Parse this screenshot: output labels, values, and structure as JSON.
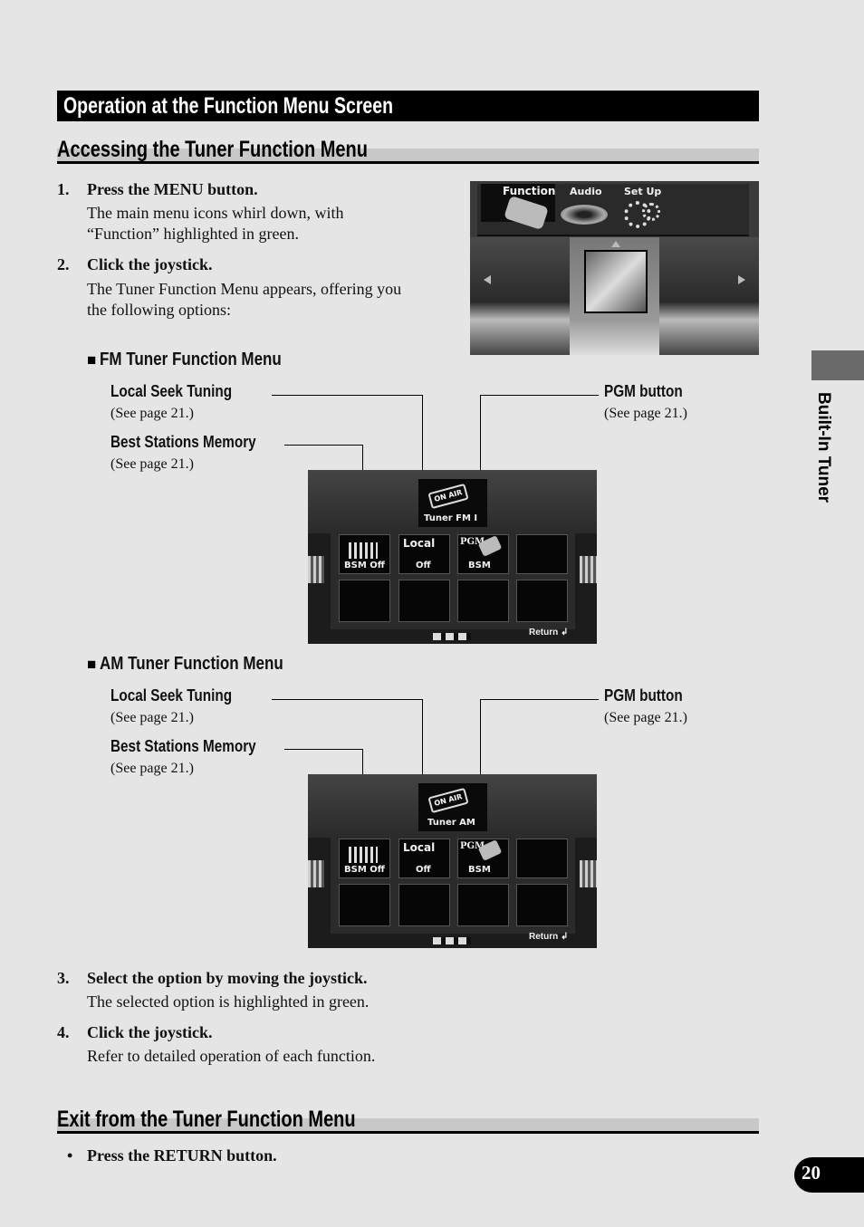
{
  "section_title": "Operation at the Function Menu Screen",
  "subsections": {
    "accessing": {
      "title": "Accessing the Tuner Function Menu"
    },
    "exit": {
      "title": "Exit from the Tuner Function Menu"
    }
  },
  "steps": [
    {
      "num": "1.",
      "title": "Press the MENU button.",
      "body_lines": [
        "The main menu icons whirl down, with",
        "“Function” highlighted in green."
      ]
    },
    {
      "num": "2.",
      "title": "Click the joystick.",
      "body_lines": [
        "The Tuner Function Menu appears, offering you",
        "the following options:"
      ]
    },
    {
      "num": "3.",
      "title": "Select the option by moving the joystick.",
      "body_lines": [
        "The selected option is highlighted in green."
      ]
    },
    {
      "num": "4.",
      "title": "Click the joystick.",
      "body_lines": [
        "Refer to detailed operation of each function."
      ]
    }
  ],
  "main_menu_screen": {
    "items": [
      "Function",
      "Audio",
      "Set Up"
    ],
    "icons": [
      "remote-control-icon",
      "speaker-icon",
      "gears-icon"
    ]
  },
  "menus": [
    {
      "heading": "FM Tuner Function Menu",
      "bullet": "■",
      "callouts": {
        "local_seek": {
          "label": "Local Seek Tuning",
          "ref": "(See page 21.)"
        },
        "bsm": {
          "label": "Best Stations Memory",
          "ref": "(See page 21.)"
        },
        "pgm": {
          "label": "PGM button",
          "ref": "(See page 21.)"
        }
      },
      "screen": {
        "title": "Tuner FM I",
        "onair": "ON AIR",
        "tiles": [
          {
            "top": "",
            "bottom": "BSM Off"
          },
          {
            "top": "Local",
            "bottom": "Off"
          },
          {
            "top": "PGM",
            "bottom": "BSM"
          }
        ],
        "return_label": "Return"
      }
    },
    {
      "heading": "AM Tuner Function Menu",
      "bullet": "■",
      "callouts": {
        "local_seek": {
          "label": "Local Seek Tuning",
          "ref": "(See page 21.)"
        },
        "bsm": {
          "label": "Best Stations Memory",
          "ref": "(See page 21.)"
        },
        "pgm": {
          "label": "PGM button",
          "ref": "(See page 21.)"
        }
      },
      "screen": {
        "title": "Tuner AM",
        "onair": "ON AIR",
        "tiles": [
          {
            "top": "",
            "bottom": "BSM Off"
          },
          {
            "top": "Local",
            "bottom": "Off"
          },
          {
            "top": "PGM",
            "bottom": "BSM"
          }
        ],
        "return_label": "Return"
      }
    }
  ],
  "exit_bullet": {
    "bullet": "•",
    "text": "Press the RETURN button."
  },
  "side_tab": {
    "label": "Built-In Tuner"
  },
  "page_number": "20"
}
